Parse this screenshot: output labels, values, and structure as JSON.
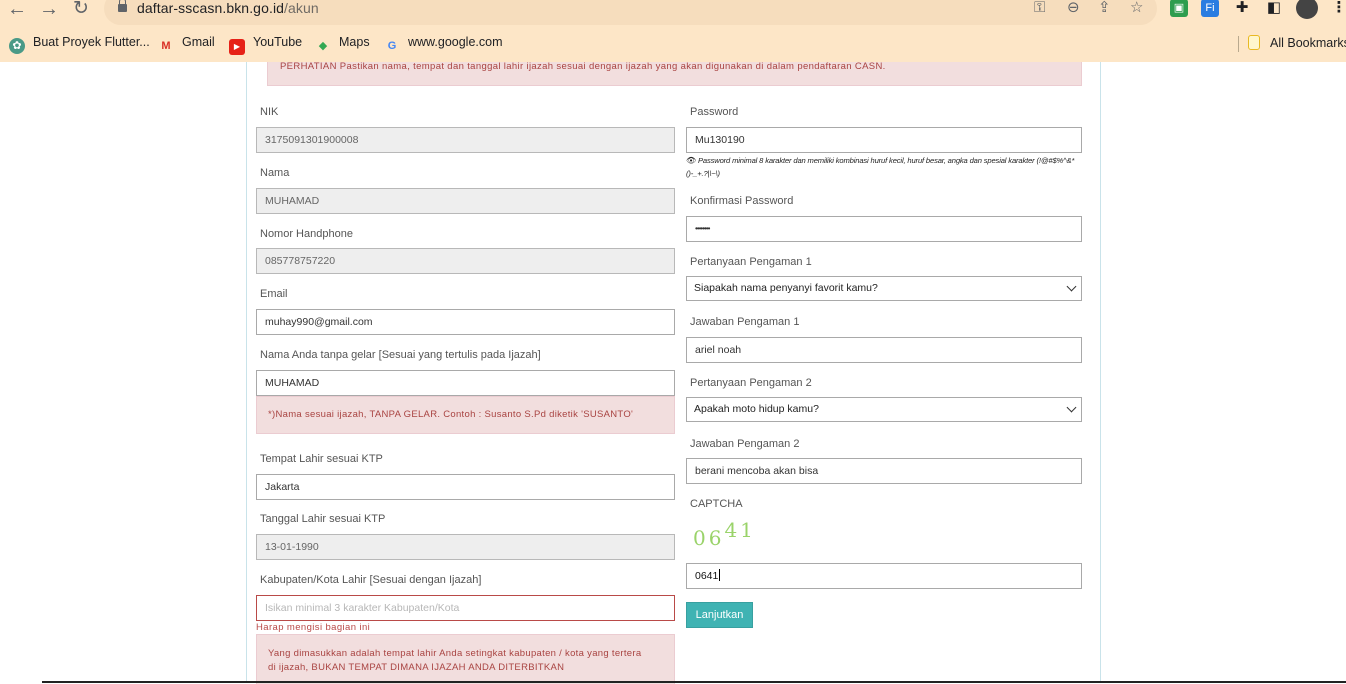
{
  "browser": {
    "url_domain": "daftar-sscasn.bkn.go.id",
    "url_path": "/akun",
    "bookmarks": [
      {
        "label": "Buat Proyek Flutter...",
        "icon": "flutter-project-icon"
      },
      {
        "label": "Gmail",
        "icon": "gmail-icon"
      },
      {
        "label": "YouTube",
        "icon": "youtube-icon"
      },
      {
        "label": "Maps",
        "icon": "maps-icon"
      },
      {
        "label": "www.google.com",
        "icon": "google-icon"
      }
    ],
    "all_bookmarks": "All Bookmarks"
  },
  "notice": "PERHATIAN Pastikan nama, tempat dan tanggal lahir ijazah sesuai dengan ijazah yang akan digunakan di dalam pendaftaran CASN.",
  "left": {
    "nik": {
      "label": "NIK",
      "value": "3175091301900008"
    },
    "nama": {
      "label": "Nama",
      "value": "MUHAMAD"
    },
    "hp": {
      "label": "Nomor Handphone",
      "value": "085778757220"
    },
    "email": {
      "label": "Email",
      "value": "muhay990@gmail.com"
    },
    "nama_ijazah": {
      "label": "Nama Anda tanpa gelar [Sesuai yang tertulis pada Ijazah]",
      "value": "MUHAMAD",
      "alert": "*)Nama sesuai ijazah, TANPA GELAR. Contoh : Susanto S.Pd diketik 'SUSANTO'"
    },
    "tempat": {
      "label": "Tempat Lahir sesuai KTP",
      "value": "Jakarta"
    },
    "tanggal": {
      "label": "Tanggal Lahir sesuai KTP",
      "value": "13-01-1990"
    },
    "kabupaten": {
      "label": "Kabupaten/Kota Lahir [Sesuai dengan Ijazah]",
      "placeholder": "Isikan minimal 3 karakter Kabupaten/Kota",
      "error": "Harap mengisi bagian ini",
      "alert_line1": "Yang dimasukkan adalah tempat lahir Anda setingkat kabupaten / kota yang tertera",
      "alert_line2": "di ijazah, BUKAN TEMPAT DIMANA IJAZAH ANDA DITERBITKAN"
    }
  },
  "right": {
    "password": {
      "label": "Password",
      "value": "Mu130190",
      "hint_line1": "Password minimal 8 karakter dan memiliki kombinasi huruf kecil, huruf besar, angka dan spesial karakter (!@#$%^&*",
      "hint_line2": "()-_+.?|\\~\\)"
    },
    "konfirmasi": {
      "label": "Konfirmasi Password",
      "value": "••••••••"
    },
    "q1": {
      "label": "Pertanyaan Pengaman 1",
      "value": "Siapakah nama penyanyi favorit kamu?"
    },
    "a1": {
      "label": "Jawaban Pengaman 1",
      "value": "ariel noah"
    },
    "q2": {
      "label": "Pertanyaan Pengaman 2",
      "value": "Apakah moto hidup kamu?"
    },
    "a2": {
      "label": "Jawaban Pengaman 2",
      "value": "berani mencoba akan bisa"
    },
    "captcha": {
      "label": "CAPTCHA",
      "image_text_a": "06",
      "image_text_b": "41",
      "value": "0641"
    },
    "submit": "Lanjutkan"
  }
}
